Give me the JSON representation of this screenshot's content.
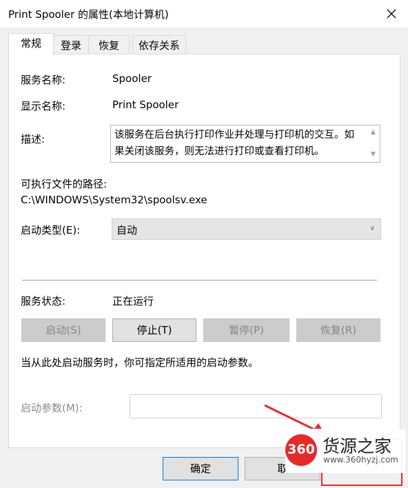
{
  "window": {
    "title": "Print Spooler 的属性(本地计算机)"
  },
  "tabs": [
    {
      "label": "常规",
      "active": true
    },
    {
      "label": "登录",
      "active": false
    },
    {
      "label": "恢复",
      "active": false
    },
    {
      "label": "依存关系",
      "active": false
    }
  ],
  "general": {
    "service_name_label": "服务名称:",
    "service_name": "Spooler",
    "display_name_label": "显示名称:",
    "display_name": "Print Spooler",
    "description_label": "描述:",
    "description": "该服务在后台执行打印作业并处理与打印机的交互。如果关闭该服务，则无法进行打印或查看打印机。",
    "path_label": "可执行文件的路径:",
    "path": "C:\\WINDOWS\\System32\\spoolsv.exe",
    "startup_type_label": "启动类型(E):",
    "startup_type": "自动",
    "status_label": "服务状态:",
    "status": "正在运行",
    "buttons": {
      "start": "启动(S)",
      "stop": "停止(T)",
      "pause": "暂停(P)",
      "resume": "恢复(R)"
    },
    "hint": "当从此处启动服务时，你可指定所适用的启动参数。",
    "params_label": "启动参数(M):",
    "params_value": ""
  },
  "footer": {
    "ok": "确定",
    "cancel": "取"
  },
  "watermark": {
    "logo": "360",
    "title": "货源之家",
    "url": "www.360hyzj.com"
  },
  "colors": {
    "accent_blue": "#0078d7",
    "highlight_red": "#e8292c",
    "dialog_bg": "#f0f0f0"
  }
}
